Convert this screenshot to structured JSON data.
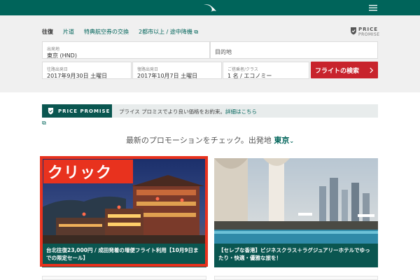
{
  "header": {
    "logo_icon": "brushwing-logo-icon",
    "menu_icon": "hamburger-menu-icon",
    "bg_color": "#00645a"
  },
  "search": {
    "tabs": [
      {
        "label": "往復",
        "active": true
      },
      {
        "label": "片道",
        "active": false
      },
      {
        "label": "特典航空券の交換",
        "active": false
      },
      {
        "label": "2都市以上 / 途中降機",
        "active": false
      }
    ],
    "price_promise_badge": {
      "line1": "PRICE",
      "line2": "PROMISE"
    },
    "origin": {
      "label": "出発地",
      "value": "東京 (HND)"
    },
    "destination": {
      "label": "目的地"
    },
    "depart": {
      "label": "往路出発日",
      "value": "2017年9月30日 土曜日"
    },
    "return": {
      "label": "復路出発日",
      "value": "2017年10月7日 土曜日"
    },
    "passengers": {
      "label": "ご搭乗者/クラス",
      "value": "1 名 / エコノミー"
    },
    "search_button": "フライトの検索",
    "accent_color": "#c8232c"
  },
  "price_promise_banner": {
    "title": "PRICE PROMISE",
    "text": "プライス プロミスでより良い価格をお約束。",
    "link": "詳細はこちら"
  },
  "promotions": {
    "heading": "最新のプロモーションをチェック。出発地",
    "city": "東京",
    "cards": [
      {
        "caption": "台北往復23,000円 / 成田発着の増便フライト利用【10月9日までの限定セール】"
      },
      {
        "caption": "【セレブな香港】ビジネスクラス＋ラグジュアリーホテルでゆったり・快適・優雅な旅を！"
      }
    ]
  },
  "annotation": {
    "label": "クリック",
    "color": "#e8321e"
  }
}
